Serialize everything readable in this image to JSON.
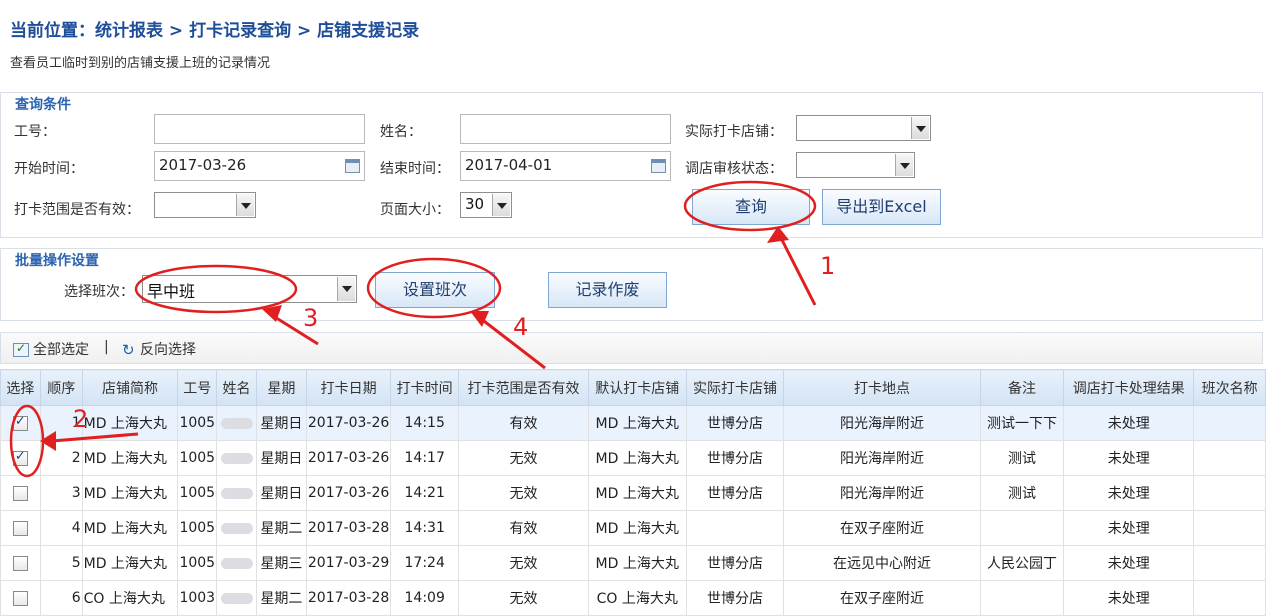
{
  "breadcrumb": "当前位置：统计报表 > 打卡记录查询 > 店铺支援记录",
  "description": "查看员工临时到别的店铺支援上班的记录情况",
  "query": {
    "title": "查询条件",
    "employee_id_label": "工号：",
    "employee_id_value": "",
    "name_label": "姓名：",
    "name_value": "",
    "actual_store_label": "实际打卡店铺：",
    "actual_store_value": "",
    "start_label": "开始时间：",
    "start_value": "2017-03-26",
    "end_label": "结束时间：",
    "end_value": "2017-04-01",
    "audit_label": "调店审核状态：",
    "audit_value": "",
    "range_label": "打卡范围是否有效：",
    "range_value": "",
    "page_size_label": "页面大小：",
    "page_size_value": "30",
    "query_button": "查询",
    "export_button": "导出到Excel"
  },
  "batch": {
    "title": "批量操作设置",
    "shift_label": "选择班次：",
    "shift_value": "早中班",
    "set_shift_button": "设置班次",
    "void_button": "记录作废"
  },
  "toolbar": {
    "select_all": "全部选定",
    "separator": "|",
    "invert": "反向选择"
  },
  "table": {
    "columns": [
      "选择",
      "顺序",
      "店铺简称",
      "工号",
      "姓名",
      "星期",
      "打卡日期",
      "打卡时间",
      "打卡范围是否有效",
      "默认打卡店铺",
      "实际打卡店铺",
      "打卡地点",
      "备注",
      "调店打卡处理结果",
      "班次名称"
    ],
    "rows": [
      {
        "checked": true,
        "seq": "1",
        "store": "MD 上海大丸",
        "emp": "1005",
        "week": "星期日",
        "date": "2017-03-26",
        "time": "14:15",
        "valid": "有效",
        "default_store": "MD 上海大丸",
        "actual_store": "世博分店",
        "location": "阳光海岸附近",
        "remark": "测试一下下",
        "result": "未处理",
        "shift": ""
      },
      {
        "checked": true,
        "seq": "2",
        "store": "MD 上海大丸",
        "emp": "1005",
        "week": "星期日",
        "date": "2017-03-26",
        "time": "14:17",
        "valid": "无效",
        "default_store": "MD 上海大丸",
        "actual_store": "世博分店",
        "location": "阳光海岸附近",
        "remark": "测试",
        "result": "未处理",
        "shift": ""
      },
      {
        "checked": false,
        "seq": "3",
        "store": "MD 上海大丸",
        "emp": "1005",
        "week": "星期日",
        "date": "2017-03-26",
        "time": "14:21",
        "valid": "无效",
        "default_store": "MD 上海大丸",
        "actual_store": "世博分店",
        "location": "阳光海岸附近",
        "remark": "测试",
        "result": "未处理",
        "shift": ""
      },
      {
        "checked": false,
        "seq": "4",
        "store": "MD 上海大丸",
        "emp": "1005",
        "week": "星期二",
        "date": "2017-03-28",
        "time": "14:31",
        "valid": "有效",
        "default_store": "MD 上海大丸",
        "actual_store": "",
        "location": "在双子座附近",
        "remark": "",
        "result": "未处理",
        "shift": ""
      },
      {
        "checked": false,
        "seq": "5",
        "store": "MD 上海大丸",
        "emp": "1005",
        "week": "星期三",
        "date": "2017-03-29",
        "time": "17:24",
        "valid": "无效",
        "default_store": "MD 上海大丸",
        "actual_store": "世博分店",
        "location": "在远见中心附近",
        "remark": "人民公园丁",
        "result": "未处理",
        "shift": ""
      },
      {
        "checked": false,
        "seq": "6",
        "store": "CO 上海大丸",
        "emp": "1003",
        "week": "星期二",
        "date": "2017-03-28",
        "time": "14:09",
        "valid": "无效",
        "default_store": "CO 上海大丸",
        "actual_store": "世博分店",
        "location": "在双子座附近",
        "remark": "",
        "result": "未处理",
        "shift": ""
      }
    ]
  },
  "annotations": [
    "1",
    "2",
    "3",
    "4"
  ],
  "colors": {
    "annotation": "#e02020",
    "link_blue": "#1b35c9",
    "store_red": "#d01818",
    "header_bg": "#d3e3f4",
    "highlight_row": "#e9f2fd"
  }
}
